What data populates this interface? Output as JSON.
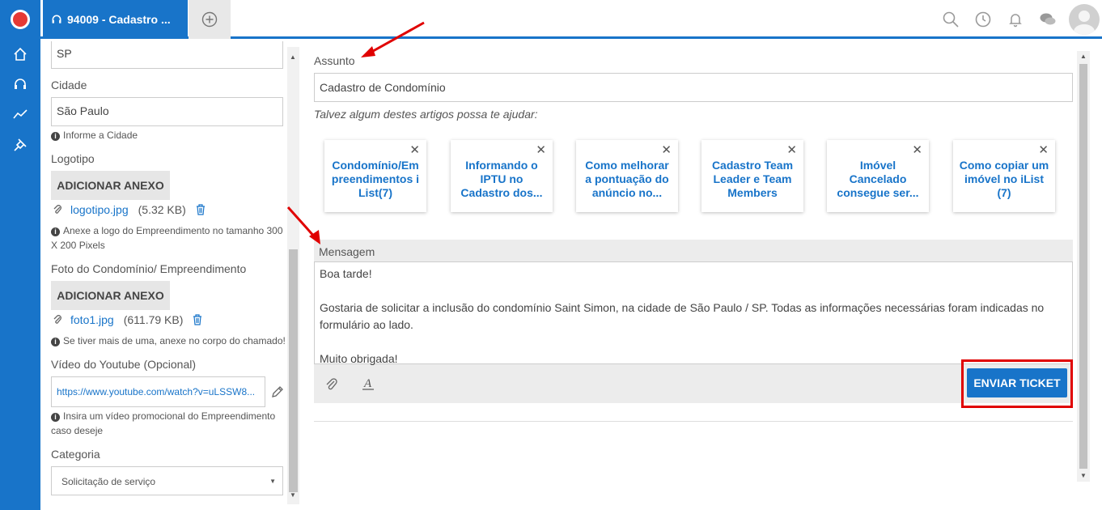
{
  "tab": {
    "title": "94009 - Cadastro ..."
  },
  "left": {
    "state_value": "SP",
    "city_label": "Cidade",
    "city_value": "São Paulo",
    "city_hint": "Informe a Cidade",
    "logo_label": "Logotipo",
    "add_attachment": "ADICIONAR ANEXO",
    "logo_file": "logotipo.jpg",
    "logo_size": "(5.32 KB)",
    "logo_hint": "Anexe a logo do Empreendimento no tamanho 300 X 200 Pixels",
    "photo_label": "Foto do Condomínio/ Empreendimento",
    "photo_file": "foto1.jpg",
    "photo_size": "(611.79 KB)",
    "photo_hint": "Se tiver mais de uma, anexe no corpo do chamado!",
    "video_label": "Vídeo do Youtube (Opcional)",
    "video_value": "https://www.youtube.com/watch?v=uLSSW8...",
    "video_hint": "Insira um vídeo promocional do Empreendimento caso deseje",
    "category_label": "Categoria",
    "category_value": "Solicitação de serviço"
  },
  "main": {
    "subject_label": "Assunto",
    "subject_value": "Cadastro de Condomínio",
    "suggest_text": "Talvez algum destes artigos possa te ajudar:",
    "articles": [
      {
        "title": "Condomínio/Empreendimentos iList(7)"
      },
      {
        "title": "Informando o IPTU no Cadastro dos..."
      },
      {
        "title": "Como melhorar a pontuação do anúncio no..."
      },
      {
        "title": "Cadastro Team Leader e Team Members"
      },
      {
        "title": "Imóvel Cancelado consegue ser..."
      },
      {
        "title": "Como copiar um imóvel no iList (7)"
      }
    ],
    "message_label": "Mensagem",
    "message_lines": [
      "Boa tarde!",
      "",
      "Gostaria de solicitar a inclusão do condomínio Saint Simon, na cidade de São Paulo / SP. Todas as informações necessárias foram indicadas no formulário ao lado.",
      "",
      "Muito obrigada!"
    ],
    "send_label": "ENVIAR TICKET"
  },
  "colors": {
    "brand": "#1874c9",
    "highlight": "#e00000"
  }
}
